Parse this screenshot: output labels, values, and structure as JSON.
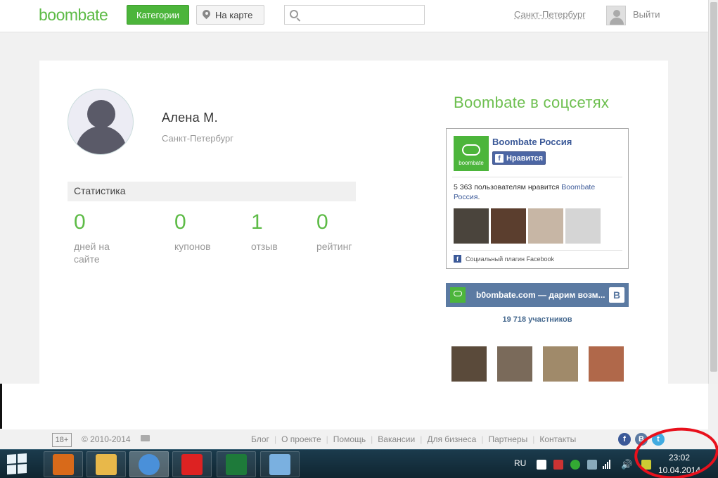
{
  "header": {
    "logo": "boombate",
    "categories_label": "Категории",
    "map_label": "На карте",
    "search_value": "",
    "search_placeholder": "",
    "city": "Санкт-Петербург",
    "logout_label": "Выйти"
  },
  "profile": {
    "name": "Алена  М.",
    "city": "Санкт-Петербург",
    "stats_title": "Статистика",
    "stats": [
      {
        "value": "0",
        "label": "дней на сайте"
      },
      {
        "value": "0",
        "label": "купонов"
      },
      {
        "value": "1",
        "label": "отзыв"
      },
      {
        "value": "0",
        "label": "рейтинг"
      }
    ]
  },
  "social": {
    "title": "Boombate в соцсетях",
    "facebook": {
      "logo_text": "boombate",
      "page_name": "Boombate Россия",
      "like_label": "Нравится",
      "count_text": "5 363 пользователям нравится",
      "count_link": "Boombate Россия",
      "count_suffix": ".",
      "plugin_label": "Социальный плагин Facebook",
      "photo_colors": [
        "#4a443c",
        "#5b3e2e",
        "#c7b6a5",
        "#d5d5d5"
      ]
    },
    "vk": {
      "name": "b0ombate.com — дарим возм...",
      "members": "19 718 участников",
      "badge": "B",
      "photo_colors": [
        "#5a4a3a",
        "#7a6a5a",
        "#a08a6a",
        "#b0684a"
      ]
    }
  },
  "footer": {
    "age": "18+",
    "copyright": "© 2010-2014",
    "links": [
      "Блог",
      "О проекте",
      "Помощь",
      "Вакансии",
      "Для бизнеса",
      "Партнеры",
      "Контакты"
    ],
    "social_icons": [
      {
        "name": "facebook-icon",
        "color": "#3b5998",
        "glyph": "f"
      },
      {
        "name": "vk-icon",
        "color": "#5b7aa2",
        "glyph": "B"
      },
      {
        "name": "twitter-icon",
        "color": "#41abe1",
        "glyph": "t"
      }
    ]
  },
  "taskbar": {
    "apps": [
      {
        "name": "media-player",
        "color": "#d86a1a"
      },
      {
        "name": "file-explorer",
        "color": "#e8b84a"
      },
      {
        "name": "chrome",
        "color": "#4a90d9"
      },
      {
        "name": "yandex-browser",
        "color": "#d22"
      },
      {
        "name": "excel",
        "color": "#1e7a3a"
      },
      {
        "name": "paint",
        "color": "#7ab0e0"
      }
    ],
    "lang": "RU",
    "time": "23:02",
    "date": "10.04.2014"
  }
}
